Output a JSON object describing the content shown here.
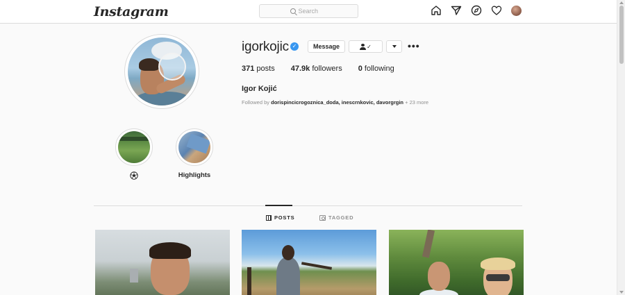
{
  "nav": {
    "logo": "Instagram",
    "search_placeholder": "Search",
    "icons": [
      "home-icon",
      "direct-icon",
      "explore-icon",
      "activity-heart-icon",
      "profile-avatar"
    ]
  },
  "profile": {
    "username": "igorkojic",
    "verified": true,
    "message_label": "Message",
    "following_check": "✓",
    "posts_count": "371",
    "posts_label": "posts",
    "followers_count": "47.9k",
    "followers_label": "followers",
    "following_count": "0",
    "following_label": "following",
    "full_name": "Igor Kojić",
    "followed_by_prefix": "Followed by",
    "followed_by_names": "dorispincicrogoznica_doda, inescrnkovic, davorgrgin",
    "followed_by_more": "+ 23 more"
  },
  "highlights": [
    {
      "label": "⚽"
    },
    {
      "label": "Highlights"
    }
  ],
  "tabs": {
    "posts": "POSTS",
    "tagged": "TAGGED",
    "active": "posts"
  },
  "colors": {
    "accent": "#3897f0",
    "text": "#262626",
    "muted": "#8e8e8e",
    "border": "#dbdbdb",
    "background": "#fafafa"
  }
}
